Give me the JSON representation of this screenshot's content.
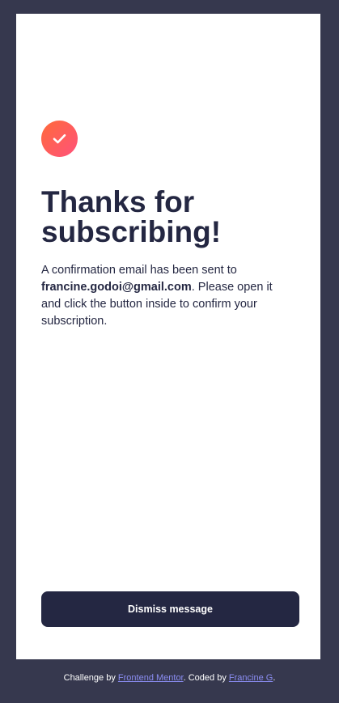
{
  "colors": {
    "page_background": "#36384e",
    "card_background": "#ffffff",
    "dark_navy": "#242742",
    "icon_gradient_start": "#ff6a3a",
    "icon_gradient_end": "#ff527b",
    "link": "#8b8df2"
  },
  "success": {
    "icon": "checkmark-icon",
    "title": "Thanks for subscribing!",
    "message_prefix": "A confirmation email has been sent to ",
    "email": "francine.godoi@gmail.com",
    "message_suffix": ". Please open it and click the button inside to confirm your subscription."
  },
  "dismiss_button": {
    "label": "Dismiss message"
  },
  "attribution": {
    "challenge_prefix": "Challenge by ",
    "challenge_link": "Frontend Mentor",
    "coded_prefix": ". Coded by ",
    "coded_link": "Francine G",
    "suffix": "."
  }
}
